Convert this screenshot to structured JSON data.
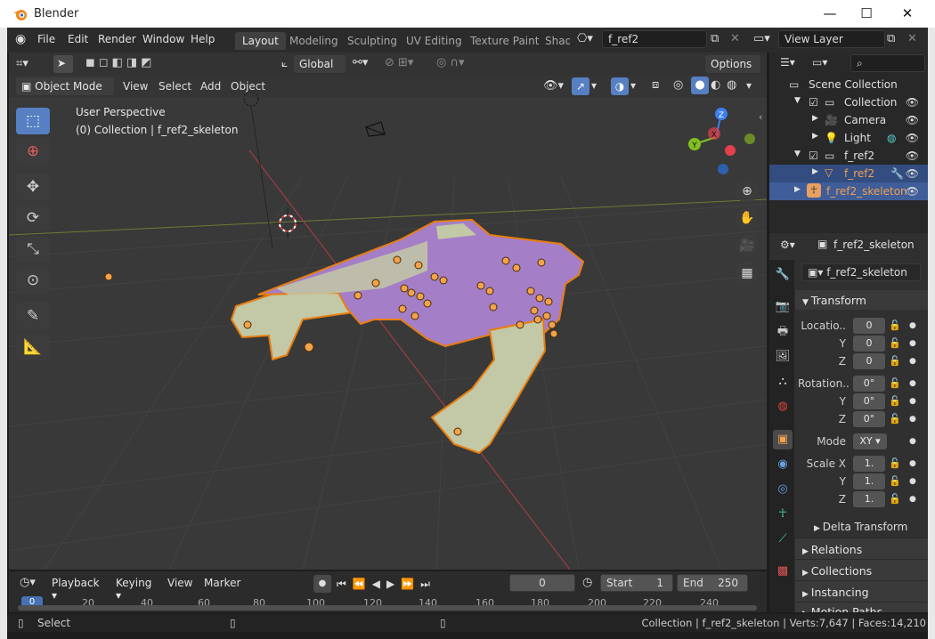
{
  "window": {
    "app_title": "Blender",
    "minimize": "—",
    "maximize": "☐",
    "close": "✕"
  },
  "menu": [
    "File",
    "Edit",
    "Render",
    "Window",
    "Help"
  ],
  "workspaces": [
    {
      "label": "Layout",
      "active": true
    },
    {
      "label": "Modeling"
    },
    {
      "label": "Sculpting"
    },
    {
      "label": "UV Editing"
    },
    {
      "label": "Texture Paint"
    },
    {
      "label": "Shad"
    }
  ],
  "scene_field": "f_ref2",
  "view_layer_field": "View Layer",
  "viewport": {
    "transform_orientation": "Global",
    "options_label": "Options",
    "mode": "Object Mode",
    "menus": [
      "View",
      "Select",
      "Add",
      "Object"
    ],
    "overlay_line1": "User Perspective",
    "overlay_line2": "(0) Collection | f_ref2_skeleton",
    "gizmo_axes": {
      "z": "Z",
      "y": "Y",
      "x": "X"
    }
  },
  "outliner": {
    "search_placeholder": "",
    "rows": [
      {
        "label": "Scene Collection"
      },
      {
        "label": "Collection"
      },
      {
        "label": "Camera"
      },
      {
        "label": "Light"
      },
      {
        "label": "f_ref2"
      },
      {
        "label": "f_ref2"
      },
      {
        "label": "f_ref2_skeleton"
      }
    ]
  },
  "properties": {
    "object_name": "f_ref2_skeleton",
    "object_field": "f_ref2_skeleton",
    "transform_title": "Transform",
    "location_label": "Locatio..",
    "location": [
      "0",
      "0",
      "0"
    ],
    "rotation_label": "Rotation..",
    "rotation": [
      "0°",
      "0°",
      "0°"
    ],
    "mode_label": "Mode",
    "mode_value": "XY",
    "scale_label": "Scale X",
    "scale": [
      "1.",
      "1.",
      "1."
    ],
    "axis_y": "Y",
    "axis_z": "Z",
    "delta_transform": "Delta Transform",
    "sections": [
      "Relations",
      "Collections",
      "Instancing",
      "Motion Paths"
    ]
  },
  "timeline": {
    "menus": [
      "Playback",
      "Keying",
      "View",
      "Marker"
    ],
    "current_frame": "0",
    "start_label": "Start",
    "start_value": "1",
    "end_label": "End",
    "end_value": "250",
    "ruler": [
      "0",
      "20",
      "40",
      "60",
      "80",
      "100",
      "120",
      "140",
      "160",
      "180",
      "200",
      "220",
      "240"
    ]
  },
  "status": {
    "left": "Select",
    "right": "Collection | f_ref2_skeleton | Verts:7,647 | Faces:14,210"
  },
  "colors": {
    "accent": "#5680c2",
    "selection_outline": "#e87d0d",
    "bone_purple": "#9c7bc4",
    "mesh_green": "#c3c8a6",
    "axis_x": "#e2404d",
    "axis_y": "#80c020",
    "axis_z": "#3b7ff0"
  }
}
